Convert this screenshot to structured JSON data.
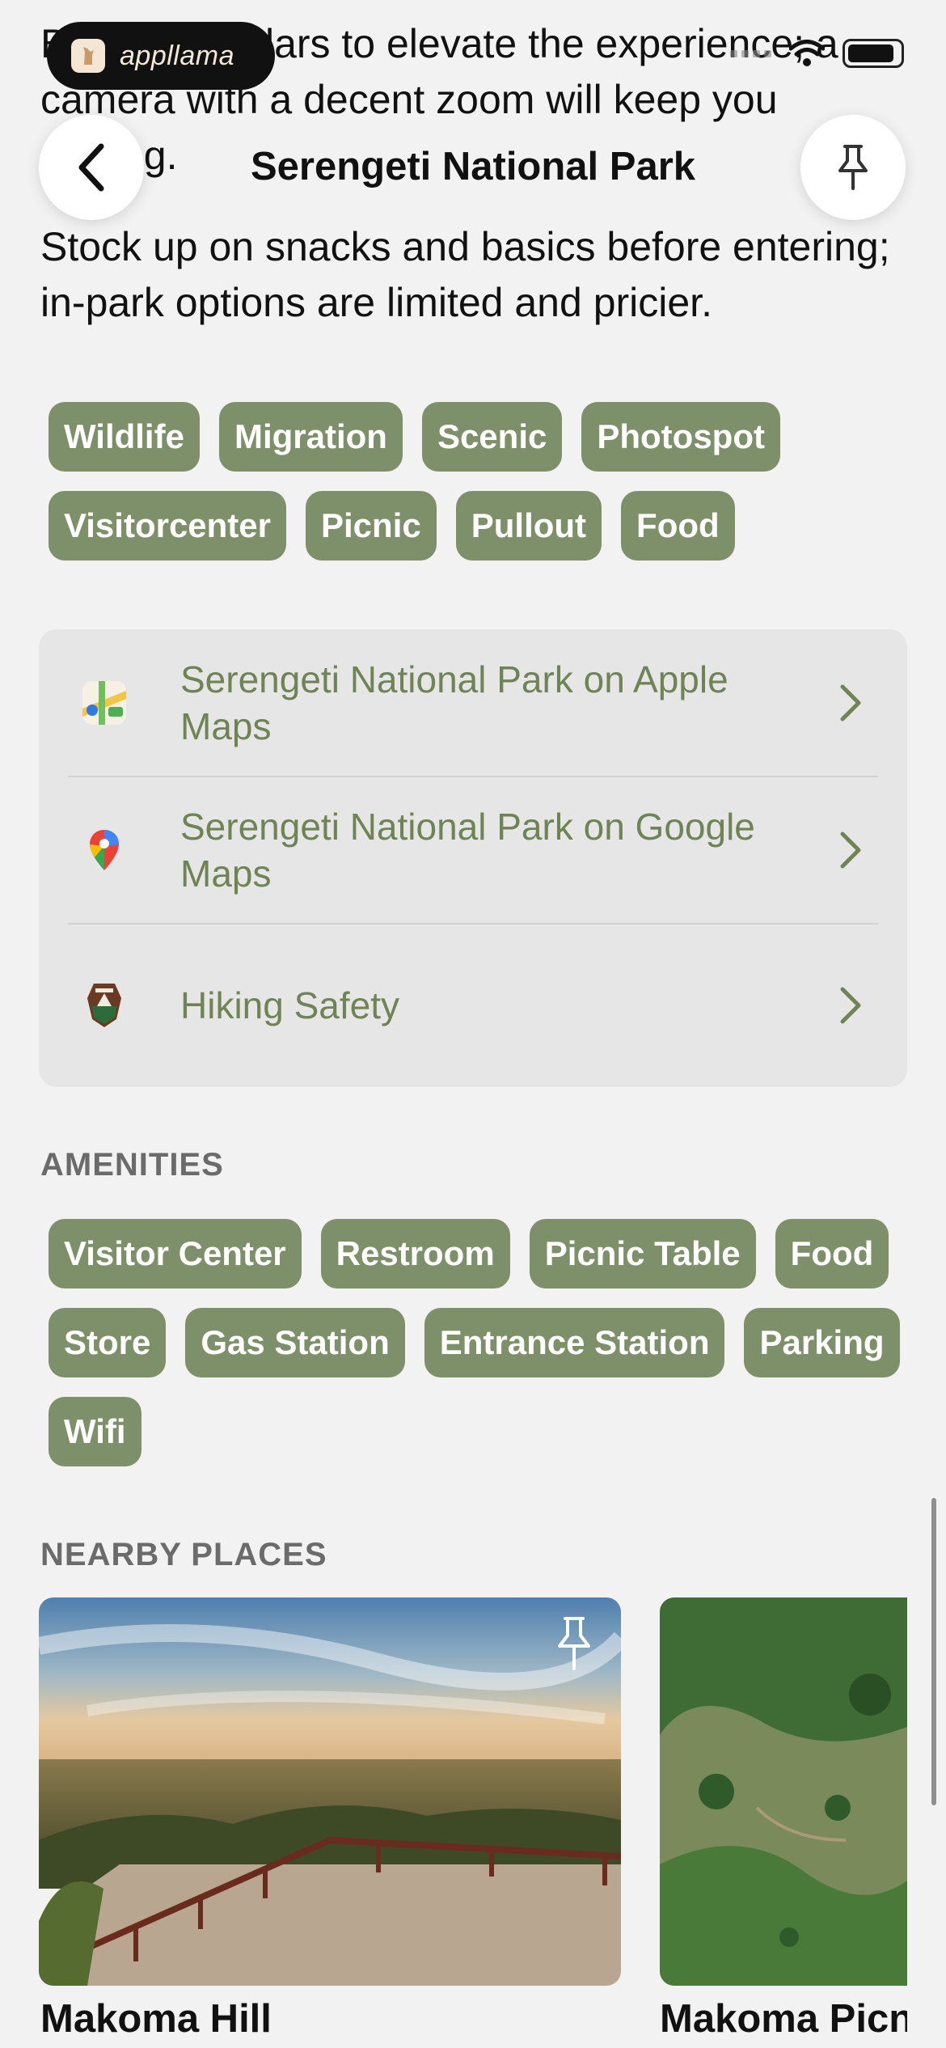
{
  "tips": [
    "Bring binoculars to elevate the experience; a camera with a decent zoom will keep you smiling.",
    "Stock up on snacks and basics before entering; in-park options are limited and pricier."
  ],
  "status_bar": {
    "app_badge": "appllama"
  },
  "nav": {
    "title": "Serengeti National Park",
    "back_icon": "chevron-left-icon",
    "pin_icon": "pin-icon"
  },
  "tags": [
    "Wildlife",
    "Migration",
    "Scenic",
    "Photospot",
    "Visitorcenter",
    "Picnic",
    "Pullout",
    "Food"
  ],
  "links": [
    {
      "label": "Serengeti National Park on Apple Maps",
      "icon": "apple-maps-icon"
    },
    {
      "label": "Serengeti National Park on Google Maps",
      "icon": "google-maps-icon"
    },
    {
      "label": "Hiking Safety",
      "icon": "nps-arrowhead-icon"
    }
  ],
  "amenities": {
    "heading": "AMENITIES",
    "items": [
      "Visitor Center",
      "Restroom",
      "Picnic Table",
      "Food",
      "Store",
      "Gas Station",
      "Entrance Station",
      "Parking",
      "Wifi"
    ]
  },
  "nearby": {
    "heading": "NEARBY PLACES",
    "places": [
      {
        "name": "Makoma Hill"
      },
      {
        "name": "Makoma Picni"
      }
    ]
  },
  "colors": {
    "accent": "#7e906a",
    "link_text": "#6f8454",
    "background": "#f2f2f2",
    "card": "#e6e6e6"
  }
}
